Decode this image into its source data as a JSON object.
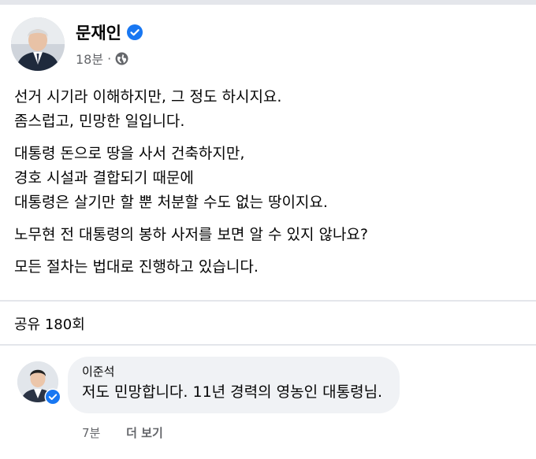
{
  "post": {
    "author": "문재인",
    "time": "18분",
    "separator": "·",
    "paragraphs": [
      [
        "선거 시기라 이해하지만, 그 정도 하시지요.",
        "좀스럽고, 민망한 일입니다."
      ],
      [
        "대통령 돈으로 땅을 사서 건축하지만,",
        "경호 시설과 결합되기 때문에",
        "대통령은 살기만 할 뿐 처분할 수도 없는 땅이지요."
      ],
      [
        "노무현 전 대통령의 봉하 사저를 보면 알 수 있지 않나요?"
      ],
      [
        "모든 절차는 법대로 진행하고 있습니다."
      ]
    ]
  },
  "share_count": "공유 180회",
  "comment": {
    "author": "이준석",
    "text": "저도 민망합니다. 11년 경력의 영농인 대통령님.",
    "time": "7분",
    "see_more": "더 보기"
  },
  "icons": {
    "verified": "verified-badge-icon",
    "audience": "globe-icon"
  },
  "colors": {
    "verified_blue": "#1877f2",
    "meta_gray": "#65676b",
    "bubble_bg": "#f0f2f5",
    "divider": "#e4e6eb"
  }
}
